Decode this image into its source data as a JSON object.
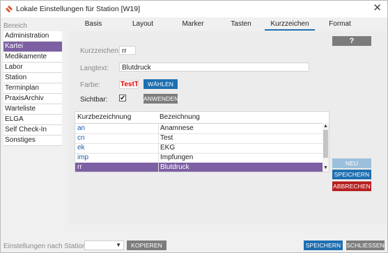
{
  "window": {
    "title": "Lokale Einstellungen für Station [W19]",
    "close_glyph": "✕"
  },
  "sidebar": {
    "header": "Bereich",
    "items": [
      {
        "label": "Administration",
        "active": false
      },
      {
        "label": "Kartei",
        "active": true
      },
      {
        "label": "Medikamente",
        "active": false
      },
      {
        "label": "Labor",
        "active": false
      },
      {
        "label": "Station",
        "active": false
      },
      {
        "label": "Terminplan",
        "active": false
      },
      {
        "label": "PraxisArchiv",
        "active": false
      },
      {
        "label": "Warteliste",
        "active": false
      },
      {
        "label": "ELGA",
        "active": false
      },
      {
        "label": "Self Check-In",
        "active": false
      },
      {
        "label": "Sonstiges",
        "active": false
      }
    ]
  },
  "tabs": [
    {
      "label": "Basis"
    },
    {
      "label": "Layout"
    },
    {
      "label": "Marker"
    },
    {
      "label": "Tasten"
    },
    {
      "label": "Kurzzeichen",
      "active": true
    },
    {
      "label": "Format"
    }
  ],
  "help_button": "?",
  "form": {
    "kurzzeichen_label": "Kurzzeichen:",
    "kurzzeichen_value": "rr",
    "langtext_label": "Langtext:",
    "langtext_value": "Blutdruck",
    "farbe_label": "Farbe:",
    "farbe_sample": "TestTe",
    "farbe_sample_color": "#e00000",
    "waehlen_button": "WÄHLEN",
    "sichtbar_label": "Sichtbar:",
    "sichtbar_checked": true,
    "checkbox_glyph": "✔",
    "anwenden_button": "ANWENDEN"
  },
  "table": {
    "columns": [
      "Kurzbezeichnung",
      "Bezeichnung"
    ],
    "rows": [
      {
        "kurz": "an",
        "bez": "Anamnese",
        "selected": false
      },
      {
        "kurz": "cn",
        "bez": "Test",
        "selected": false
      },
      {
        "kurz": "ek",
        "bez": "EKG",
        "selected": false
      },
      {
        "kurz": "imp",
        "bez": "Impfungen",
        "selected": false
      },
      {
        "kurz": "rr",
        "bez": "Blutdruck",
        "selected": true
      }
    ],
    "scroll_up_glyph": "▲",
    "scroll_down_glyph": "▼"
  },
  "actions": {
    "neu": "NEU",
    "speichern": "SPEICHERN",
    "abbrechen": "ABBRECHEN"
  },
  "footer": {
    "label": "Einstellungen nach Station",
    "select_value": "",
    "select_arrow": "▼",
    "kopieren": "KOPIEREN",
    "speichern": "SPEICHERN",
    "schliessen": "SCHLIESSEN"
  },
  "colors": {
    "accent": "#1e6fb0",
    "selection": "#7d5fa3",
    "danger": "#b72020",
    "disabled": "#9cc0dc",
    "neutral": "#7d7d7d"
  }
}
